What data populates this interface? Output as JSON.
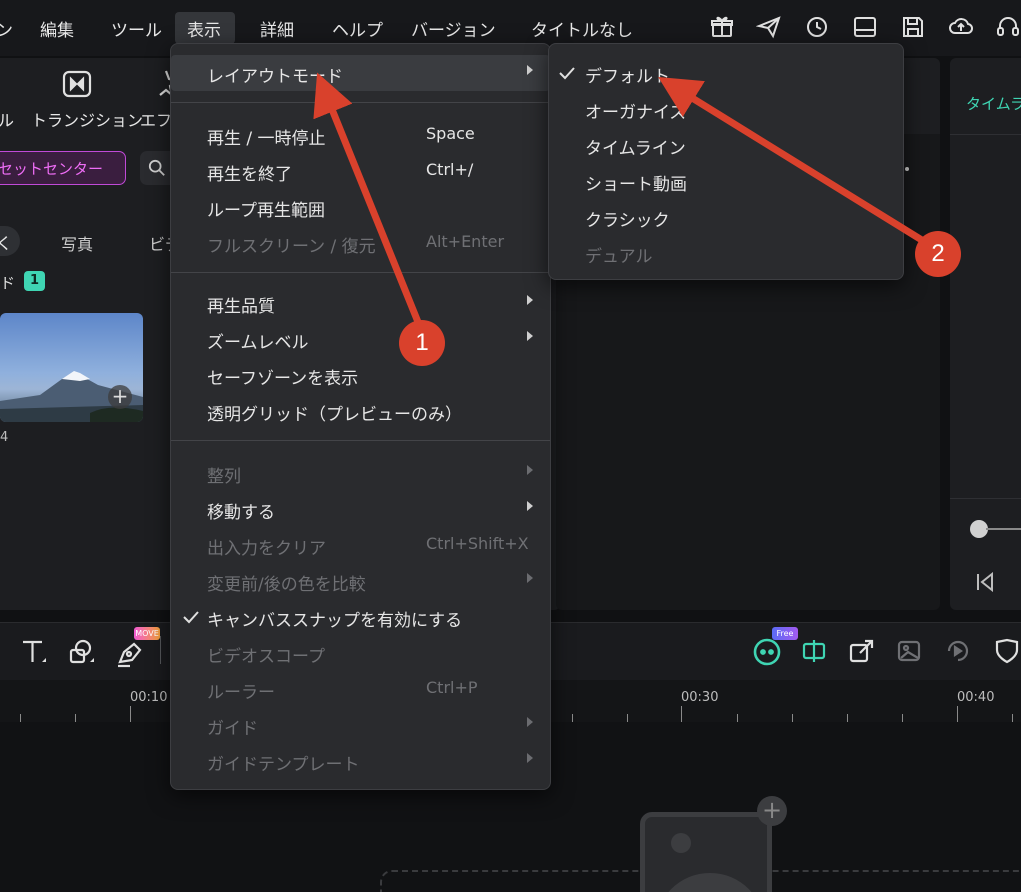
{
  "menubar": {
    "cut_item": "ン",
    "edit": "編集",
    "tools": "ツール",
    "view": "表示",
    "details": "詳細",
    "help": "ヘルプ",
    "version": "バージョン",
    "doc_title": "タイトルなし",
    "icons": [
      "gift-icon",
      "send-icon",
      "history-icon",
      "layout-icon",
      "save-icon",
      "cloud-upload-icon",
      "headset-icon"
    ]
  },
  "left_toolbar": {
    "cut_label": "ル",
    "transition": "トランジション",
    "effect": "エフェ"
  },
  "media": {
    "asset_center": "アセットセンター",
    "tab_photo": "写真",
    "tab_video_cut": "ビデ",
    "tab_cut": "く",
    "folder_label": "ド",
    "folder_count": "1",
    "thumb_caption": "4"
  },
  "preview": {
    "right_tab": "タイムラ"
  },
  "timeline": {
    "times": [
      "00:10",
      "00:30",
      "00:40"
    ],
    "move_badge": "MOVE",
    "free_badge": "Free"
  },
  "view_menu": {
    "layout_mode": "レイアウトモード",
    "play_pause": "再生 / 一時停止",
    "play_pause_sc": "Space",
    "stop": "再生を終了",
    "stop_sc": "Ctrl+/",
    "loop": "ループ再生範囲",
    "fullscreen": "フルスクリーン / 復元",
    "fullscreen_sc": "Alt+Enter",
    "quality": "再生品質",
    "zoom": "ズームレベル",
    "safe_zone": "セーフゾーンを表示",
    "grid": "透明グリッド（プレビューのみ）",
    "align": "整列",
    "move": "移動する",
    "clear_io": "出入力をクリア",
    "clear_io_sc": "Ctrl+Shift+X",
    "compare": "変更前/後の色を比較",
    "snap": "キャンバススナップを有効にする",
    "scope": "ビデオスコープ",
    "ruler": "ルーラー",
    "ruler_sc": "Ctrl+P",
    "guide": "ガイド",
    "guide_template": "ガイドテンプレート"
  },
  "layout_submenu": {
    "default": "デフォルト",
    "organize": "オーガナイズ",
    "timeline": "タイムライン",
    "short_video": "ショート動画",
    "classic": "クラシック",
    "dual": "デュアル"
  },
  "callouts": {
    "one": "1",
    "two": "2"
  },
  "colors": {
    "accent": "#3fd5b3",
    "annotation": "#d9412c",
    "asset_pink": "#ee6df5"
  }
}
